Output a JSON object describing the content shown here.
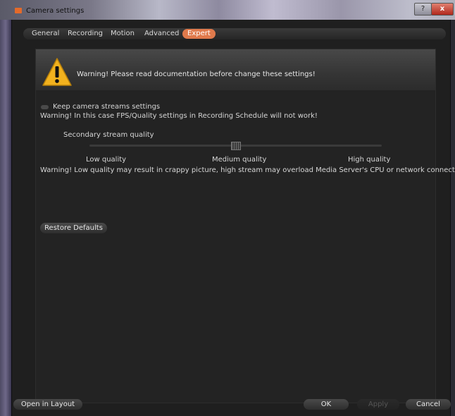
{
  "window": {
    "title": "Camera settings",
    "help_label": "?",
    "close_label": "x"
  },
  "tabs": [
    {
      "label": "General"
    },
    {
      "label": "Recording"
    },
    {
      "label": "Motion"
    },
    {
      "label": "Advanced"
    },
    {
      "label": "Expert",
      "active": true
    }
  ],
  "panel": {
    "warning_text": "Warning! Please read documentation before change these settings!",
    "keep_streams_label": "Keep camera streams settings",
    "keep_streams_checked": false,
    "keep_streams_warning": "Warning! In this case FPS/Quality settings in Recording Schedule will not work!",
    "secondary_quality_label": "Secondary stream quality",
    "slider_value": 0.5,
    "quality_labels": [
      "Low quality",
      "Medium quality",
      "High quality"
    ],
    "quality_warning": "Warning! Low quality may result in crappy picture, high stream may overload Media Server's CPU or network connection",
    "restore_label": "Restore Defaults"
  },
  "footer": {
    "open_in_layout_label": "Open in Layout",
    "ok_label": "OK",
    "apply_label": "Apply",
    "cancel_label": "Cancel"
  },
  "colors": {
    "accent": "#e07a4c",
    "background": "#1f1f1f",
    "warning_icon": "#f2b21e"
  }
}
